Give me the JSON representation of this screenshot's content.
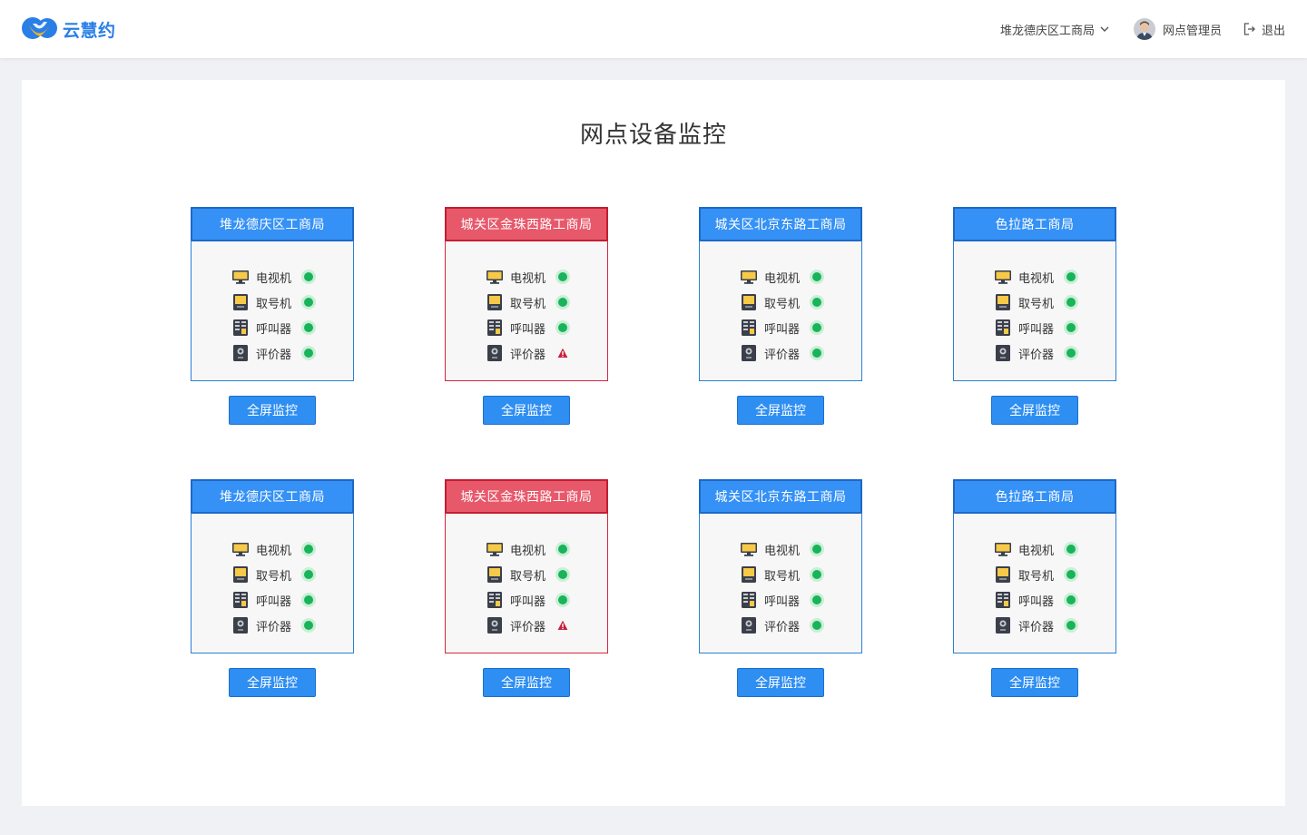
{
  "header": {
    "logo_text": "云慧约",
    "branch_selector": "堆龙德庆区工商局",
    "user_name": "网点管理员",
    "logout_label": "退出"
  },
  "page_title": "网点设备监控",
  "colors": {
    "accent": "#2e8ef2",
    "alert": "#e7596a",
    "status_ok": "#19b35a",
    "status_warn": "#c8213a"
  },
  "cards": [
    {
      "name": "堆龙德庆区工商局",
      "alert": false,
      "button": "全屏监控",
      "devices": [
        {
          "label": "电视机",
          "icon": "tv-icon",
          "status": "ok"
        },
        {
          "label": "取号机",
          "icon": "ticket-machine-icon",
          "status": "ok"
        },
        {
          "label": "呼叫器",
          "icon": "caller-icon",
          "status": "ok"
        },
        {
          "label": "评价器",
          "icon": "evaluator-icon",
          "status": "ok"
        }
      ]
    },
    {
      "name": "城关区金珠西路工商局",
      "alert": true,
      "button": "全屏监控",
      "devices": [
        {
          "label": "电视机",
          "icon": "tv-icon",
          "status": "ok"
        },
        {
          "label": "取号机",
          "icon": "ticket-machine-icon",
          "status": "ok"
        },
        {
          "label": "呼叫器",
          "icon": "caller-icon",
          "status": "ok"
        },
        {
          "label": "评价器",
          "icon": "evaluator-icon",
          "status": "warning"
        }
      ]
    },
    {
      "name": "城关区北京东路工商局",
      "alert": false,
      "button": "全屏监控",
      "devices": [
        {
          "label": "电视机",
          "icon": "tv-icon",
          "status": "ok"
        },
        {
          "label": "取号机",
          "icon": "ticket-machine-icon",
          "status": "ok"
        },
        {
          "label": "呼叫器",
          "icon": "caller-icon",
          "status": "ok"
        },
        {
          "label": "评价器",
          "icon": "evaluator-icon",
          "status": "ok"
        }
      ]
    },
    {
      "name": "色拉路工商局",
      "alert": false,
      "button": "全屏监控",
      "devices": [
        {
          "label": "电视机",
          "icon": "tv-icon",
          "status": "ok"
        },
        {
          "label": "取号机",
          "icon": "ticket-machine-icon",
          "status": "ok"
        },
        {
          "label": "呼叫器",
          "icon": "caller-icon",
          "status": "ok"
        },
        {
          "label": "评价器",
          "icon": "evaluator-icon",
          "status": "ok"
        }
      ]
    },
    {
      "name": "堆龙德庆区工商局",
      "alert": false,
      "button": "全屏监控",
      "devices": [
        {
          "label": "电视机",
          "icon": "tv-icon",
          "status": "ok"
        },
        {
          "label": "取号机",
          "icon": "ticket-machine-icon",
          "status": "ok"
        },
        {
          "label": "呼叫器",
          "icon": "caller-icon",
          "status": "ok"
        },
        {
          "label": "评价器",
          "icon": "evaluator-icon",
          "status": "ok"
        }
      ]
    },
    {
      "name": "城关区金珠西路工商局",
      "alert": true,
      "button": "全屏监控",
      "devices": [
        {
          "label": "电视机",
          "icon": "tv-icon",
          "status": "ok"
        },
        {
          "label": "取号机",
          "icon": "ticket-machine-icon",
          "status": "ok"
        },
        {
          "label": "呼叫器",
          "icon": "caller-icon",
          "status": "ok"
        },
        {
          "label": "评价器",
          "icon": "evaluator-icon",
          "status": "warning"
        }
      ]
    },
    {
      "name": "城关区北京东路工商局",
      "alert": false,
      "button": "全屏监控",
      "devices": [
        {
          "label": "电视机",
          "icon": "tv-icon",
          "status": "ok"
        },
        {
          "label": "取号机",
          "icon": "ticket-machine-icon",
          "status": "ok"
        },
        {
          "label": "呼叫器",
          "icon": "caller-icon",
          "status": "ok"
        },
        {
          "label": "评价器",
          "icon": "evaluator-icon",
          "status": "ok"
        }
      ]
    },
    {
      "name": "色拉路工商局",
      "alert": false,
      "button": "全屏监控",
      "devices": [
        {
          "label": "电视机",
          "icon": "tv-icon",
          "status": "ok"
        },
        {
          "label": "取号机",
          "icon": "ticket-machine-icon",
          "status": "ok"
        },
        {
          "label": "呼叫器",
          "icon": "caller-icon",
          "status": "ok"
        },
        {
          "label": "评价器",
          "icon": "evaluator-icon",
          "status": "ok"
        }
      ]
    }
  ]
}
